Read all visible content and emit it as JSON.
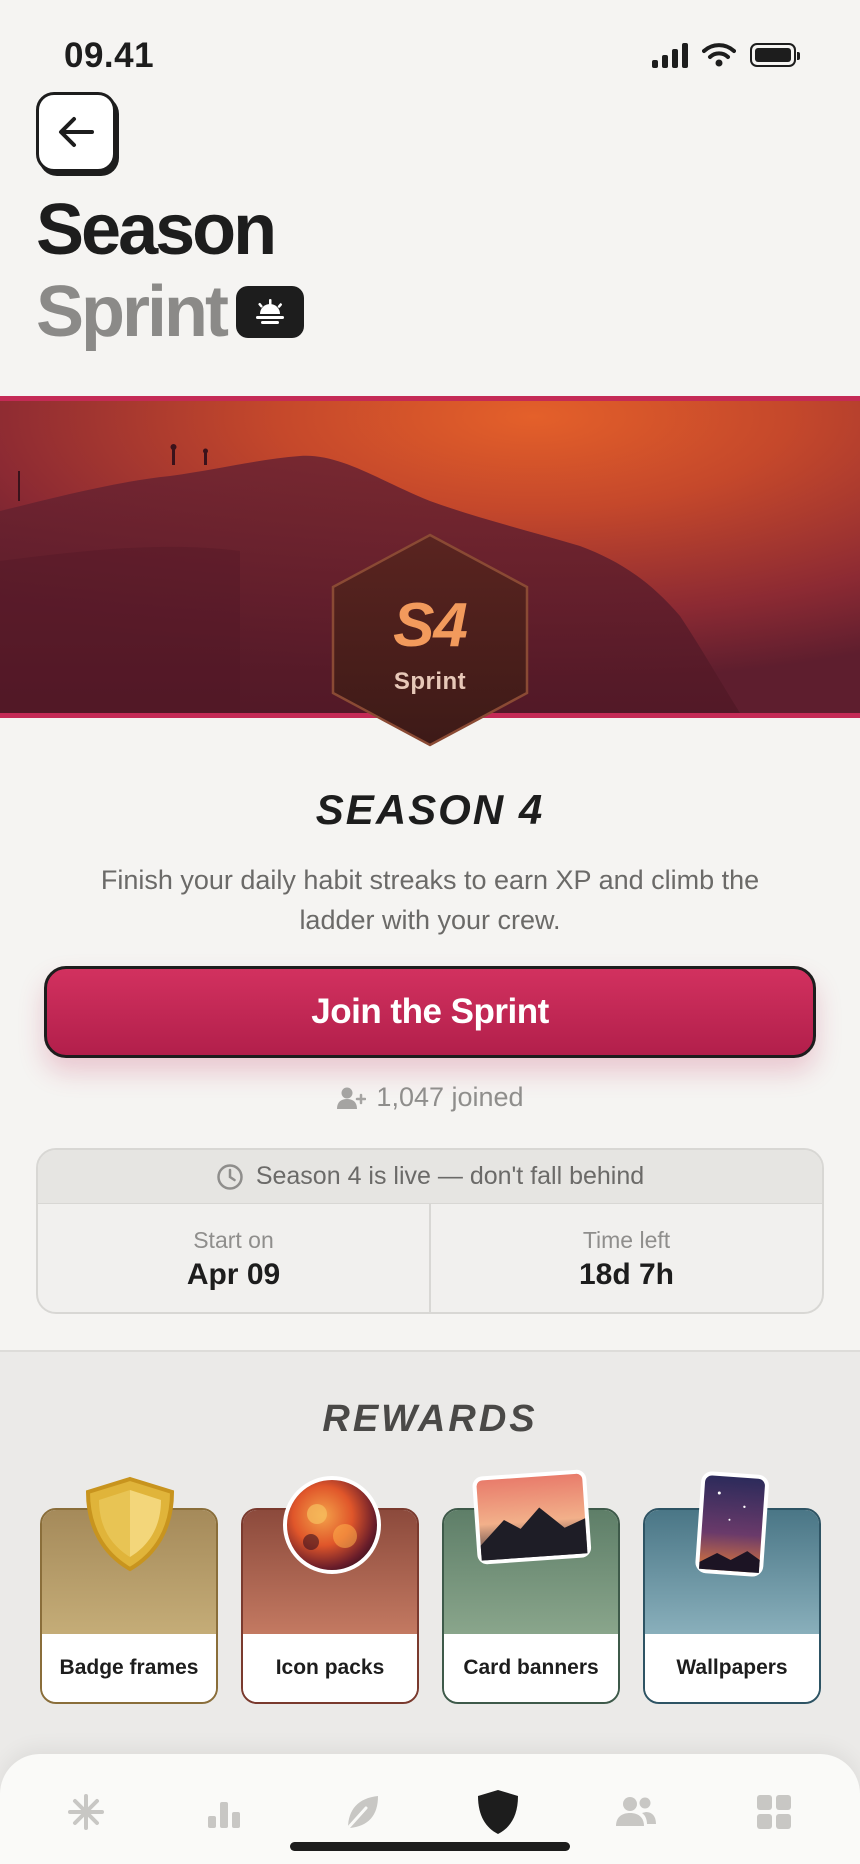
{
  "status": {
    "time": "09.41"
  },
  "header": {
    "title_line1": "Season",
    "title_line2": "Sprint"
  },
  "hero": {
    "badge_code": "S4",
    "badge_sub": "Sprint"
  },
  "season": {
    "heading": "SEASON 4",
    "description": "Finish your daily habit streaks to earn XP and climb the ladder with your crew.",
    "cta_label": "Join the Sprint",
    "joined_text": "1,047 joined",
    "notice": "Season 4 is live — don't fall behind",
    "start_label": "Start on",
    "start_value": "Apr 09",
    "time_left_label": "Time left",
    "time_left_value": "18d 7h"
  },
  "rewards": {
    "heading": "REWARDS",
    "items": [
      {
        "label": "Badge frames",
        "icon": "shield-icon"
      },
      {
        "label": "Icon packs",
        "icon": "orb-icon"
      },
      {
        "label": "Card banners",
        "icon": "landscape-icon"
      },
      {
        "label": "Wallpapers",
        "icon": "phone-wallpaper-icon"
      }
    ]
  },
  "tabs": [
    {
      "icon": "sparkle-icon",
      "active": false
    },
    {
      "icon": "stats-icon",
      "active": false
    },
    {
      "icon": "leaf-icon",
      "active": false
    },
    {
      "icon": "shield-icon",
      "active": true
    },
    {
      "icon": "people-icon",
      "active": false
    },
    {
      "icon": "grid-icon",
      "active": false
    }
  ],
  "colors": {
    "accent": "#c42a56",
    "background": "#f5f4f2",
    "text": "#1d1d1d",
    "muted": "#8b8a88"
  }
}
